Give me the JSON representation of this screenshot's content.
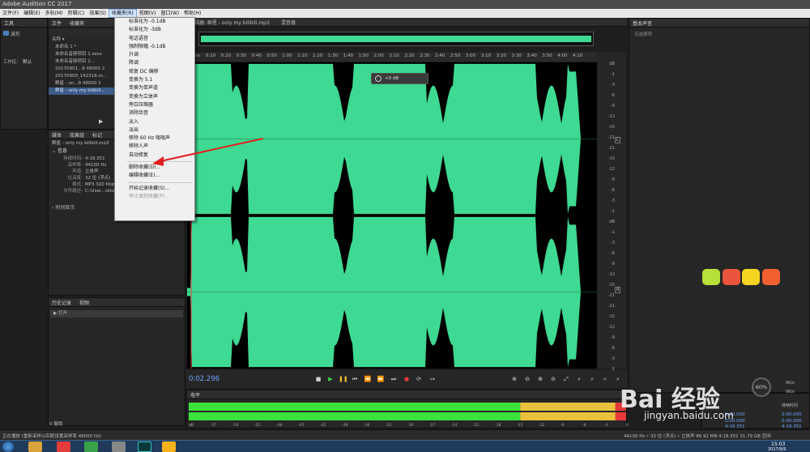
{
  "window": {
    "title": "Adobe Audition CC 2017"
  },
  "menubar": {
    "items": [
      "文件(F)",
      "编辑(E)",
      "多轨(M)",
      "剪辑(C)",
      "效果(S)",
      "收藏夹(R)",
      "视图(V)",
      "窗口(W)",
      "帮助(H)"
    ],
    "active_index": 5
  },
  "dropdown": {
    "items": [
      "标准化为 -0.1dB",
      "标准化为 -3dB",
      "电话语音",
      "强制限幅 -0.1dB",
      "升调",
      "降调",
      "修复 DC 偏移",
      "变换为 5.1",
      "变换为单声道",
      "变换为立体声",
      "旁白压缩器",
      "消除齿音",
      "淡入",
      "淡出",
      "移除 60 Hz 嗡嗡声",
      "移除人声",
      "自动修复"
    ],
    "items2": [
      "删除收藏(D)...",
      "编辑收藏(E)..."
    ],
    "items3": [
      "开始记录收藏(S)...",
      "停止录制收藏(P)..."
    ]
  },
  "tools_panel": {
    "tab": "工具",
    "mode": "波形",
    "workspace_label": "工作区:",
    "workspace_value": "默认"
  },
  "files_panel": {
    "tabs": [
      "文件",
      "收藏夹"
    ],
    "header": "名称 ▾",
    "rows": [
      "未命名 1 *",
      "未命名音频项目 1.sesx",
      "未命名音频项目 2...",
      "20170901...8 48000 2",
      "20170909_142318.m...",
      "群星 - on...8 48000 2",
      "群星 - only my bilibili..."
    ],
    "selected_index": 6
  },
  "media_panel": {
    "tabs": [
      "媒体",
      "效果组",
      "标记"
    ],
    "file": "群星 - only my bilibili.mp3"
  },
  "info": {
    "section": "信息",
    "rows": [
      {
        "k": "持续时间:",
        "v": "4:18.351"
      },
      {
        "k": "采样率:",
        "v": "44100 Hz"
      },
      {
        "k": "声道:",
        "v": "立体声"
      },
      {
        "k": "位深度:",
        "v": "32 位 (浮点)"
      },
      {
        "k": "格式:",
        "v": "MP3 320 Kbps CBR"
      },
      {
        "k": "文件路径:",
        "v": "C:\\User...sktop\\群星"
      }
    ],
    "time_display": "时间显示"
  },
  "history_panel": {
    "tabs": [
      "历史记录",
      "视频"
    ],
    "row": "打开",
    "status": "0 撤销"
  },
  "editor": {
    "tab1": "编辑器: 群星 - only my bilibili.mp3",
    "tab2": "混音器",
    "ruler": [
      "hms",
      "0:10",
      "0:20",
      "0:30",
      "0:40",
      "0:50",
      "1:00",
      "1:10",
      "1:20",
      "1:30",
      "1:40",
      "1:50",
      "2:00",
      "2:10",
      "2:20",
      "2:30",
      "2:40",
      "2:50",
      "3:00",
      "3:10",
      "3:20",
      "3:30",
      "3:40",
      "3:50",
      "4:00",
      "4:10"
    ],
    "db_scale": [
      "dB",
      "-1",
      "-3",
      "-6",
      "-9",
      "-12",
      "-15",
      "-21",
      "-21",
      "-15",
      "-12",
      "-9",
      "-6",
      "-3",
      "-1"
    ],
    "hud_value": "+0 dB",
    "channel_l": "L",
    "channel_r": "R",
    "current_time": "0:02.296"
  },
  "levels": {
    "title": "电平",
    "scale": [
      "dB",
      "-57",
      "-54",
      "-51",
      "-48",
      "-45",
      "-42",
      "-39",
      "-36",
      "-33",
      "-30",
      "-27",
      "-24",
      "-21",
      "-18",
      "-15",
      "-12",
      "-9",
      "-6",
      "-3",
      "0"
    ]
  },
  "essential_sound": {
    "title": "基本声音",
    "subtitle": "无选择项"
  },
  "selection_panel": {
    "label_duration": "持续时间",
    "rows": [
      [
        "0:00.000",
        "0:00.000"
      ],
      [
        "0:00.000",
        "0:00.000"
      ],
      [
        "4:18.351",
        "4:18.351"
      ]
    ]
  },
  "status_bar": {
    "left": "正在播放 (重新采样以匹配设置采样率 48000 Hz)",
    "right": "44100 Hz • 32 位 (浮点) • 立体声   86.92 MB   4:18.351   31.79 GB 空闲"
  },
  "taskbar": {
    "time": "15:03",
    "date": "2017/9/9"
  },
  "network": {
    "pct": "60%",
    "down": "0K/s",
    "up": "0K/s"
  },
  "watermark": {
    "brand": "Bai 经验",
    "url": "jingyan.baidu.com"
  },
  "colors": {
    "wave": "#3ed992",
    "meter_green": "#3be23b",
    "meter_yellow": "#e9c23d",
    "meter_red": "#e83a3a",
    "arrow": "#e02020",
    "accent": "#3d5c88"
  }
}
